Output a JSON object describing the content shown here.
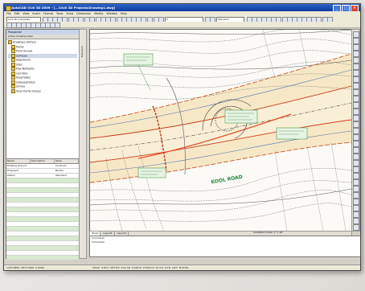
{
  "window": {
    "title": "AutoCAD Civil 3D 2009 - [...\\Civil 3D Projects\\Drawing1.dwg]"
  },
  "menus": [
    "File",
    "Edit",
    "View",
    "Insert",
    "Format",
    "Tools",
    "Draw",
    "Dimension",
    "Modify",
    "Window",
    "Help"
  ],
  "toolbar": {
    "workspace": "Civil 3D Complete",
    "layer_combo": "0",
    "style_combo": "Standard"
  },
  "panel": {
    "title": "Prospector",
    "tab": "Active Drawing View",
    "tree": [
      "Drawing1 (Active)",
      "Points",
      "Point Groups",
      "Surfaces",
      "Alignments",
      "Sites",
      "Pipe Networks",
      "Corridors",
      "Assemblies",
      "Subassemblies",
      "Survey",
      "View Frame Groups"
    ],
    "grid_columns": [
      "Name",
      "Description",
      "Style"
    ],
    "grid_rows": [
      [
        "Existing Ground",
        "",
        "Contours"
      ],
      [
        "Proposed",
        "",
        "Border"
      ],
      [
        "Datum",
        "",
        "Standard"
      ]
    ]
  },
  "side_tabs": {
    "left": "Toolspace",
    "right": "Settings"
  },
  "drawing": {
    "road_label": "KOOL ROAD"
  },
  "layout_tabs": [
    "Model",
    "Layout1",
    "Layout2"
  ],
  "annotation": "Annotation Scale: 1\" = 40'",
  "command": {
    "line1": "Command:",
    "line2": "Command:"
  },
  "status": {
    "coords": "1325.6850, 9874.3000, 0.0000",
    "toggles": "SNAP GRID ORTHO POLAR OSNAP OTRACK DUCS DYN LWT MODEL"
  }
}
